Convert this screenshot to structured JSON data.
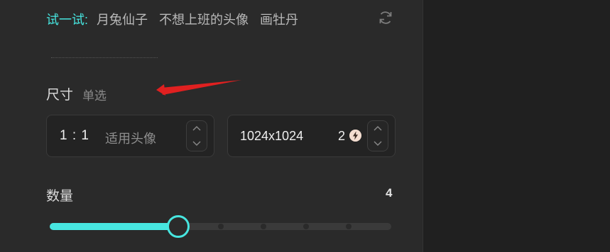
{
  "try_section": {
    "label": "试一试:",
    "suggestions": [
      "月兔仙子",
      "不想上班的头像",
      "画牡丹"
    ]
  },
  "size_section": {
    "title": "尺寸",
    "hint": "单选",
    "ratio": {
      "value": "1 : 1",
      "description": "适用头像"
    },
    "resolution": {
      "value": "1024x1024",
      "cost": "2"
    }
  },
  "quantity_section": {
    "title": "数量",
    "value": "4",
    "slider": {
      "min": 1,
      "max": 9,
      "current": 4
    }
  },
  "colors": {
    "accent": "#47e6e0",
    "panel_bg": "#2a2a2a",
    "annotation_arrow": "#e02020"
  },
  "icons": [
    "refresh-icon",
    "bolt-icon",
    "chevron-up-icon",
    "chevron-down-icon"
  ]
}
